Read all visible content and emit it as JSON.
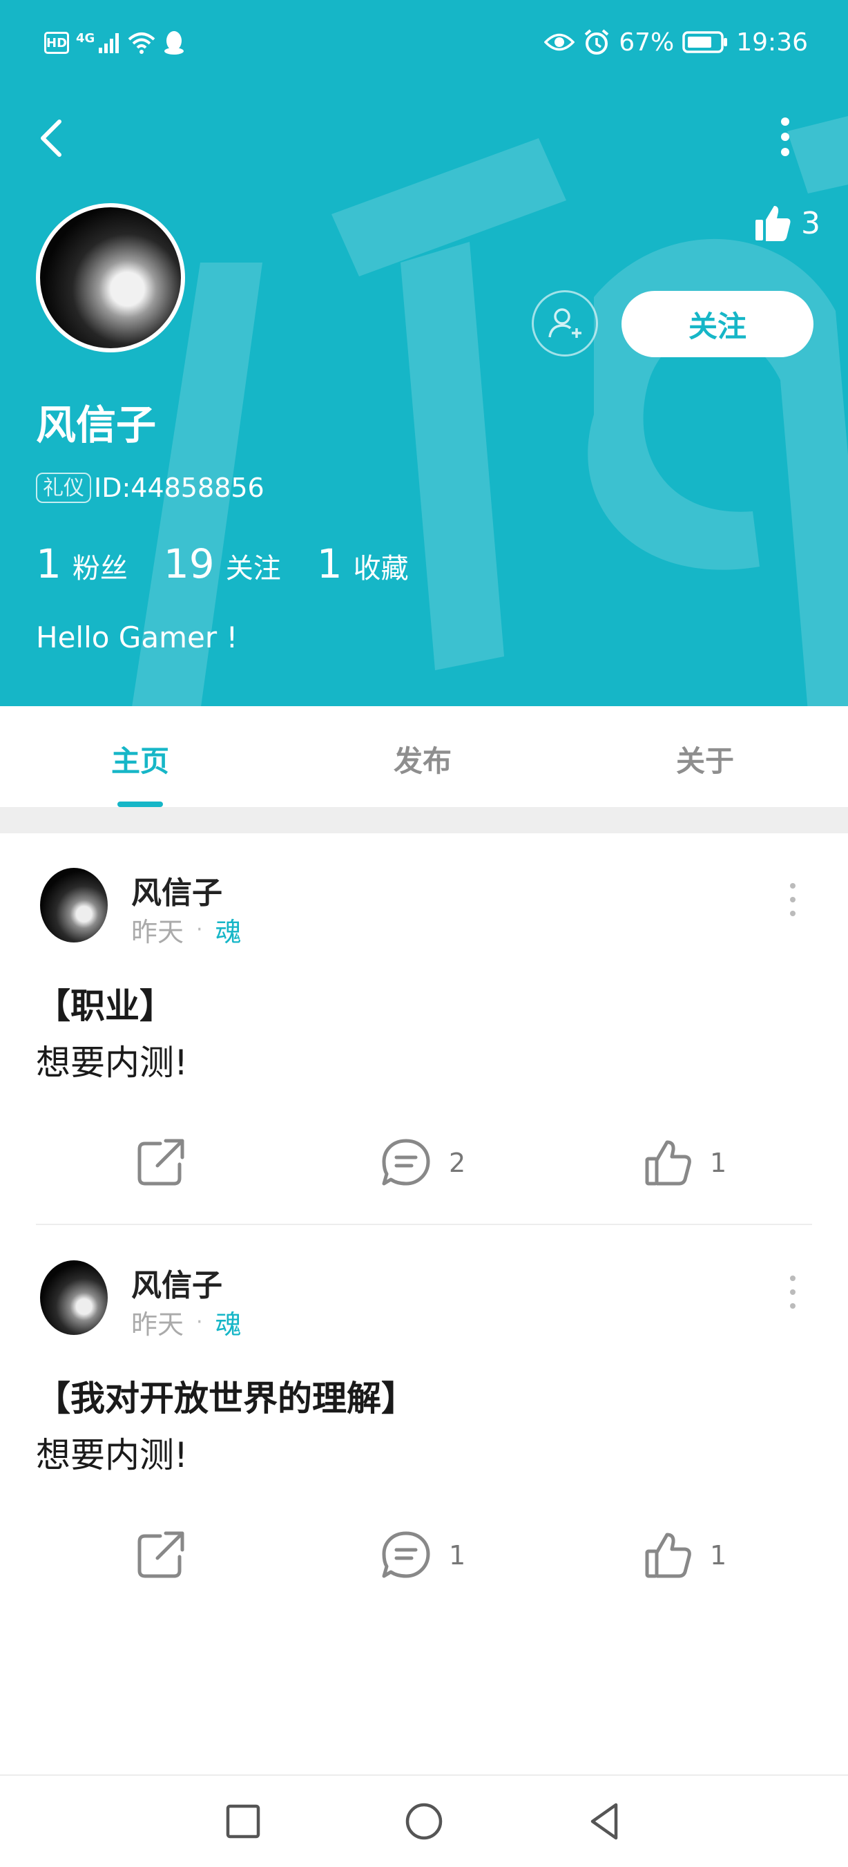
{
  "status_bar": {
    "hd": "HD",
    "network": "4G",
    "battery_percent": "67%",
    "time": "19:36"
  },
  "profile": {
    "likes": "3",
    "follow_label": "关注",
    "username": "风信子",
    "badge": "礼仪",
    "user_id": "ID:44858856",
    "stats": [
      {
        "num": "1",
        "label": "粉丝"
      },
      {
        "num": "19",
        "label": "关注"
      },
      {
        "num": "1",
        "label": "收藏"
      }
    ],
    "bio": "Hello Gamer !"
  },
  "tabs": [
    {
      "label": "主页",
      "active": true
    },
    {
      "label": "发布",
      "active": false
    },
    {
      "label": "关于",
      "active": false
    }
  ],
  "posts": [
    {
      "author": "风信子",
      "time": "昨天",
      "dot": "·",
      "tag": "魂",
      "title": "【职业】",
      "content": "想要内测!",
      "comments": "2",
      "likes": "1"
    },
    {
      "author": "风信子",
      "time": "昨天",
      "dot": "·",
      "tag": "魂",
      "title": "【我对开放世界的理解】",
      "content": "想要内测!",
      "comments": "1",
      "likes": "1"
    }
  ],
  "colors": {
    "accent": "#16b6c7",
    "text_dark": "#1a1a1a",
    "muted": "#aaaaaa"
  }
}
